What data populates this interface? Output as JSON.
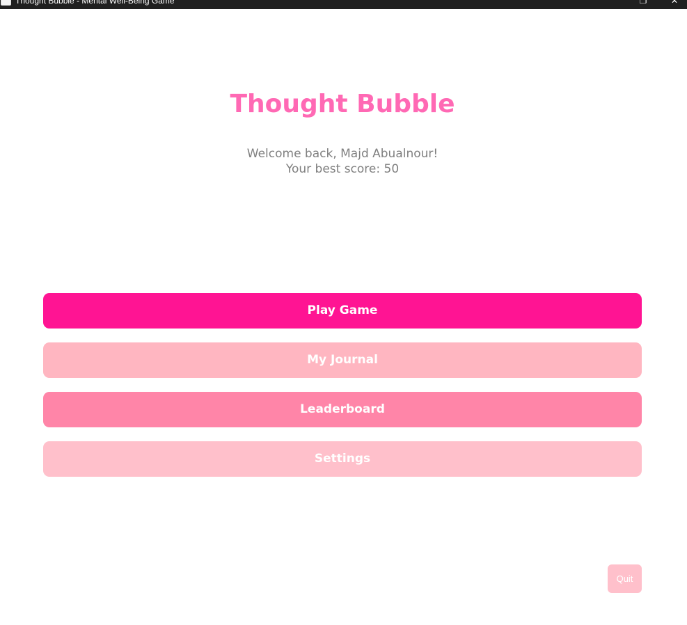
{
  "window": {
    "title": "Thought Bubble - Mental Well-Being Game",
    "restore_glyph": "❐",
    "close_glyph": "✕"
  },
  "main": {
    "title": "Thought Bubble",
    "welcome": "Welcome back, Majd Abualnour!",
    "best_score": "Your best score: 50"
  },
  "menu": {
    "play": "Play Game",
    "journal": "My Journal",
    "leaderboard": "Leaderboard",
    "settings": "Settings"
  },
  "quit_label": "Quit",
  "colors": {
    "title": "#ff69b4",
    "play": "#ff1493",
    "journal": "#ffb6c1",
    "leaderboard": "#ff85a8",
    "settings": "#ffc0cb",
    "quit": "#ffc0cb",
    "text_muted": "#808080"
  }
}
